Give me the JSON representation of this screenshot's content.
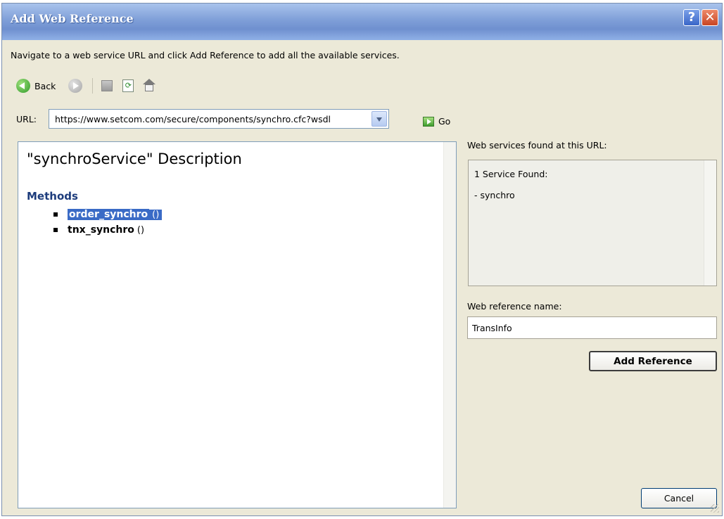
{
  "window": {
    "title": "Add Web Reference",
    "help_label": "?",
    "close_label": "✕"
  },
  "instruction": "Navigate to a web service URL and click Add Reference to add all the available services.",
  "toolbar": {
    "back_label": "Back",
    "icons": [
      "back-icon",
      "forward-icon",
      "stop-icon",
      "refresh-icon",
      "home-icon"
    ]
  },
  "url": {
    "label": "URL:",
    "value": "https://www.setcom.com/secure/components/synchro.cfc?wsdl",
    "go_label": "Go"
  },
  "browser": {
    "title": "\"synchroService\" Description",
    "methods_heading": "Methods",
    "methods": [
      {
        "name": "order_synchro",
        "parens": "()",
        "selected": true
      },
      {
        "name": "tnx_synchro",
        "parens": "()",
        "selected": false
      }
    ]
  },
  "services": {
    "label": "Web services found at this URL:",
    "count_text": "1 Service Found:",
    "items": [
      "- synchro"
    ]
  },
  "reference": {
    "name_label": "Web reference name:",
    "name_value": "TransInfo",
    "add_button": "Add Reference"
  },
  "footer": {
    "cancel_button": "Cancel"
  },
  "colors": {
    "dialog_bg": "#ECE9D8",
    "titlebar": "#7F9FD8",
    "selection": "#3A6BC6",
    "methods_heading": "#1D3C7C"
  }
}
